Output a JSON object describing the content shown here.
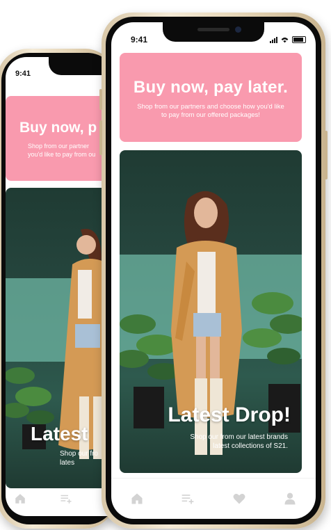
{
  "status_bar": {
    "time": "9:41"
  },
  "banner": {
    "title": "Buy now, pay later.",
    "subtitle": "Shop from our partners and choose how you'd like to pay from our offered packages!",
    "back_title": "Buy now, p",
    "back_subtitle_line1": "Shop from our partner",
    "back_subtitle_line2": "you'd like to pay from ou"
  },
  "hero": {
    "title": "Latest Drop!",
    "subtitle_line1": "Shop our from our latest brands",
    "subtitle_line2": "latest collections of S21.",
    "back_title": "Latest",
    "back_subtitle_line1": "Shop our fro",
    "back_subtitle_line2": "lates"
  },
  "tabbar": {
    "items": [
      {
        "icon": "home-icon"
      },
      {
        "icon": "playlist-add-icon"
      },
      {
        "icon": "heart-icon"
      },
      {
        "icon": "person-icon"
      }
    ]
  },
  "colors": {
    "banner_pink": "#f99aae",
    "tab_icon_gray": "#d3d3d3",
    "hero_green": "#274840"
  }
}
